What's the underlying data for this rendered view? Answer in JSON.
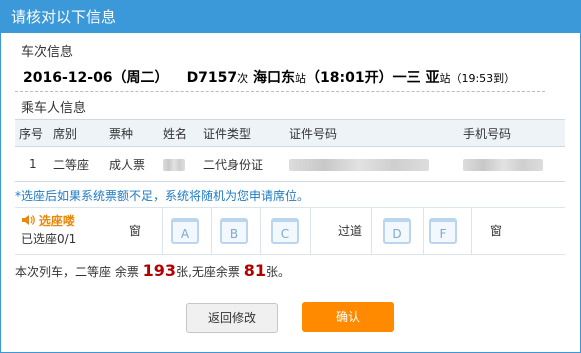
{
  "title": "请核对以下信息",
  "train_section_label": "车次信息",
  "train": {
    "date": "2016-12-06（周二）",
    "number": "D7157",
    "number_suffix": "次",
    "from": "海口东",
    "from_suffix": "站",
    "depart_time": "（18:01开）",
    "arrow": "一",
    "to": "三 亚",
    "to_suffix": "站",
    "arrive_time": "（19:53到）"
  },
  "passenger_section_label": "乘车人信息",
  "table": {
    "headers": [
      "序号",
      "席别",
      "票种",
      "姓名",
      "证件类型",
      "证件号码",
      "手机号码"
    ],
    "rows": [
      {
        "index": "1",
        "seat_class": "二等座",
        "ticket_type": "成人票",
        "id_type": "二代身份证"
      }
    ]
  },
  "notice": "*选座后如果系统票额不足，系统将随机为您申请席位。",
  "seat_select": {
    "title": "选座喽",
    "status": "已选座0/1",
    "window_left": "窗",
    "aisle": "过道",
    "window_right": "窗",
    "seats": [
      "A",
      "B",
      "C",
      "D",
      "F"
    ]
  },
  "remaining": {
    "prefix": "本次列车，二等座 余票",
    "count": "193",
    "middle": "张,无座余票",
    "no_seat_count": "81",
    "suffix": "张。"
  },
  "buttons": {
    "back": "返回修改",
    "confirm": "确认"
  },
  "colors": {
    "header_bg": "#3b99d9",
    "confirm_bg": "#ff8a00",
    "accent_red": "#b30000"
  }
}
